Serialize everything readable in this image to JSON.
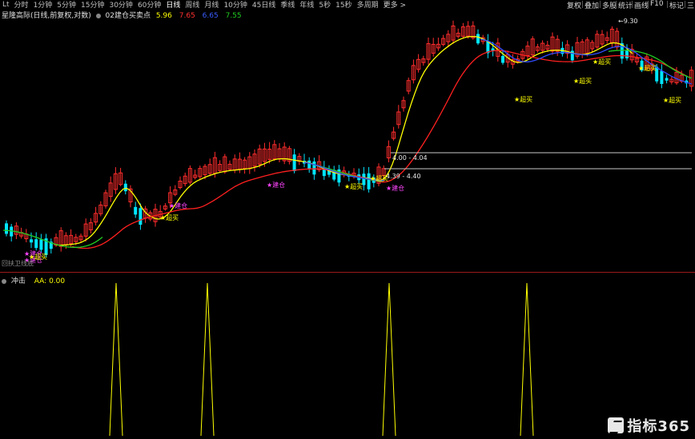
{
  "toolbar": {
    "periods": [
      {
        "label": "Lt",
        "active": false
      },
      {
        "label": "分时",
        "active": false
      },
      {
        "label": "1分钟",
        "active": false
      },
      {
        "label": "5分钟",
        "active": false
      },
      {
        "label": "15分钟",
        "active": false
      },
      {
        "label": "30分钟",
        "active": false
      },
      {
        "label": "60分钟",
        "active": false
      },
      {
        "label": "日线",
        "active": true
      },
      {
        "label": "周线",
        "active": false
      },
      {
        "label": "月线",
        "active": false
      },
      {
        "label": "10分钟",
        "active": false
      },
      {
        "label": "45日线",
        "active": false
      },
      {
        "label": "季线",
        "active": false
      },
      {
        "label": "年线",
        "active": false
      },
      {
        "label": "5秒",
        "active": false
      },
      {
        "label": "15秒",
        "active": false
      },
      {
        "label": "多周期",
        "active": false
      },
      {
        "label": "更多 >",
        "active": false
      }
    ],
    "right_buttons": [
      "复权",
      "叠加",
      "多股",
      "统计",
      "画线",
      "F10",
      "标记",
      "三"
    ]
  },
  "info": {
    "stock_label": "星隆高际(日线,前复权,对数)",
    "indicator_label": "02建仓买卖点",
    "values": [
      {
        "text": "5.96",
        "color": "#ffff00"
      },
      {
        "text": "7.65",
        "color": "#ff3030"
      },
      {
        "text": "6.65",
        "color": "#3a5cff"
      },
      {
        "text": "7.55",
        "color": "#22cc22"
      }
    ]
  },
  "main_chart": {
    "price_high_label": "9.30",
    "annotations": {
      "range_a": "4.00 - 4.04",
      "range_b": "4.39 - 4.40"
    },
    "signals": [
      {
        "text": "★建仓",
        "kind": "build"
      },
      {
        "text": "★建仓",
        "kind": "build"
      },
      {
        "text": "★建仓",
        "kind": "build"
      },
      {
        "text": "★建仓",
        "kind": "build"
      },
      {
        "text": "★建仓",
        "kind": "build"
      },
      {
        "text": "★超买",
        "kind": "buy"
      },
      {
        "text": "★超买",
        "kind": "buy"
      },
      {
        "text": "★超买",
        "kind": "buy"
      },
      {
        "text": "★超买",
        "kind": "buy"
      },
      {
        "text": "★超买",
        "kind": "buy"
      },
      {
        "text": "★超买",
        "kind": "buy"
      },
      {
        "text": "★超买",
        "kind": "buy"
      },
      {
        "text": "★超买",
        "kind": "buy"
      },
      {
        "text": "★超买",
        "kind": "buy"
      }
    ],
    "bottom_left_label": "回扶卫线底",
    "colors": {
      "up": "#ff2d2d",
      "down": "#00e5ff",
      "ma_yellow": "#ffff00",
      "ma_red": "#ff2020",
      "ma_blue": "#2f4cff",
      "ma_green": "#22cc22",
      "build": "#ff44ff",
      "buy": "#ffff00"
    }
  },
  "sub_chart": {
    "label": "冲击",
    "value_label": "AA: 0.00",
    "spike_positions": [
      145,
      259,
      486,
      658
    ]
  },
  "brand": {
    "text": "指标365"
  }
}
